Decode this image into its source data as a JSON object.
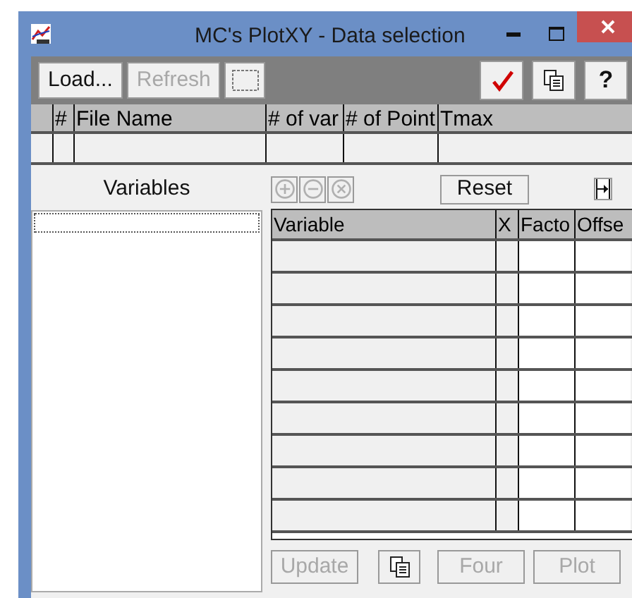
{
  "window": {
    "title": "MC's PlotXY - Data selection"
  },
  "toolbar": {
    "left_buttons": [
      {
        "kind": "text",
        "label": "Load...",
        "disabled": false
      },
      {
        "kind": "text",
        "label": "Refresh",
        "disabled": true
      },
      {
        "kind": "frame",
        "disabled": false
      }
    ],
    "right_buttons": [
      {
        "kind": "check"
      },
      {
        "kind": "copy"
      },
      {
        "kind": "text",
        "label": "?"
      }
    ]
  },
  "file_table": {
    "columns": [
      "",
      "#",
      "File Name",
      "# of var",
      "# of Point",
      "Tmax"
    ]
  },
  "variables_panel": {
    "label": "Variables"
  },
  "variable_tools": {
    "icon_buttons": [
      {
        "kind": "plus",
        "disabled": true
      },
      {
        "kind": "minus",
        "disabled": true
      },
      {
        "kind": "cross",
        "disabled": true
      }
    ],
    "reset": {
      "label": "Reset",
      "disabled": false
    }
  },
  "variable_table": {
    "columns": [
      "Variable",
      "X",
      "Facto",
      "Offse"
    ]
  },
  "bottom_buttons": [
    {
      "kind": "text",
      "label": "Update",
      "disabled": true
    },
    {
      "kind": "copy",
      "disabled": false
    },
    {
      "kind": "text",
      "label": "Four",
      "disabled": true
    },
    {
      "kind": "text",
      "label": "Plot",
      "disabled": true
    }
  ]
}
